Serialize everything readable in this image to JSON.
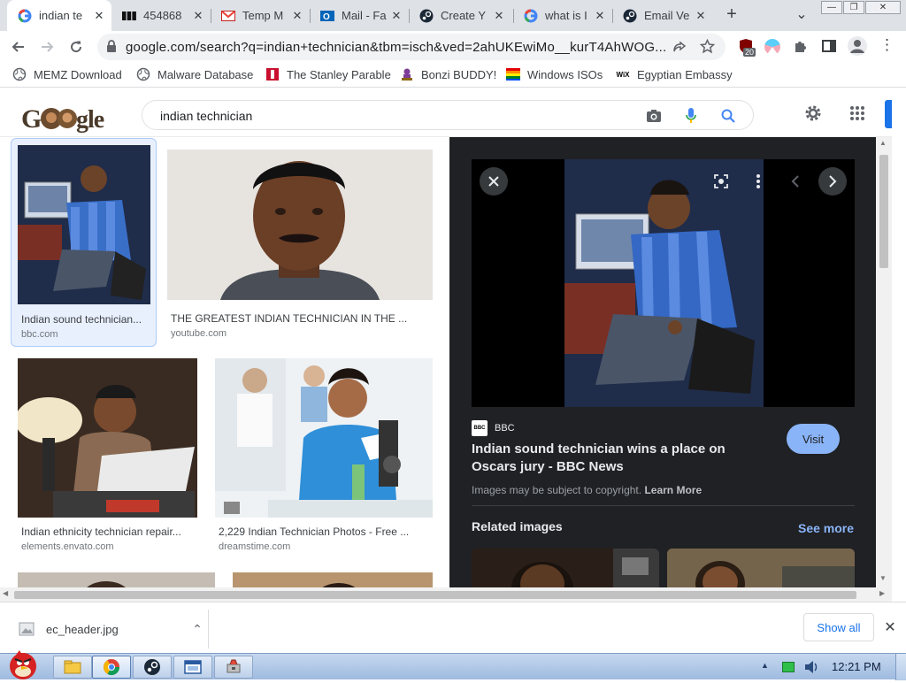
{
  "tabs": [
    {
      "title": "indian te",
      "icon": "google-icon",
      "active": true
    },
    {
      "title": "454868",
      "icon": "bbc-icon"
    },
    {
      "title": "Temp M",
      "icon": "gmail-icon"
    },
    {
      "title": "Mail - Fa",
      "icon": "outlook-icon"
    },
    {
      "title": "Create Y",
      "icon": "steam-icon"
    },
    {
      "title": "what is I",
      "icon": "google-icon"
    },
    {
      "title": "Email Ve",
      "icon": "steam-icon"
    }
  ],
  "window": {
    "new_tab": "+",
    "tab_menu": "⌄",
    "minimize": "—",
    "restore": "❐",
    "close": "✕"
  },
  "toolbar": {
    "url": "google.com/search?q=indian+technician&tbm=isch&ved=2ahUKEwiMo__kurT4AhWOG...",
    "extension_badge": "20"
  },
  "bookmarks": [
    {
      "label": "MEMZ Download",
      "icon": "globe-icon"
    },
    {
      "label": "Malware Database",
      "icon": "globe-icon"
    },
    {
      "label": "The Stanley Parable",
      "icon": "stanley-icon"
    },
    {
      "label": "Bonzi BUDDY!",
      "icon": "bonzi-icon"
    },
    {
      "label": "Windows ISOs",
      "icon": "windows-icon"
    },
    {
      "label": "Egyptian Embassy",
      "icon": "wix-icon"
    }
  ],
  "search": {
    "query": "indian technician"
  },
  "results": [
    {
      "title": "Indian sound technician...",
      "source": "bbc.com"
    },
    {
      "title": "THE GREATEST INDIAN TECHNICIAN IN THE ...",
      "source": "youtube.com"
    },
    {
      "title": "Indian ethnicity technician repair...",
      "source": "elements.envato.com"
    },
    {
      "title": "2,229 Indian Technician Photos - Free ...",
      "source": "dreamstime.com"
    }
  ],
  "panel": {
    "source_name": "BBC",
    "source_logo": "BBC",
    "title": "Indian sound technician wins a place on Oscars jury - BBC News",
    "visit_label": "Visit",
    "copyright_text": "Images may be subject to copyright.",
    "learn_more": "Learn More",
    "related_heading": "Related images",
    "see_more": "See more"
  },
  "downloads": {
    "file_name": "ec_header.jpg",
    "show_all": "Show all"
  },
  "taskbar": {
    "time": "12:21 PM"
  },
  "colors": {
    "accent": "#1a73e8",
    "panel_bg": "#202124",
    "visit_btn": "#8ab4f8",
    "see_more": "#8ab4f8"
  }
}
